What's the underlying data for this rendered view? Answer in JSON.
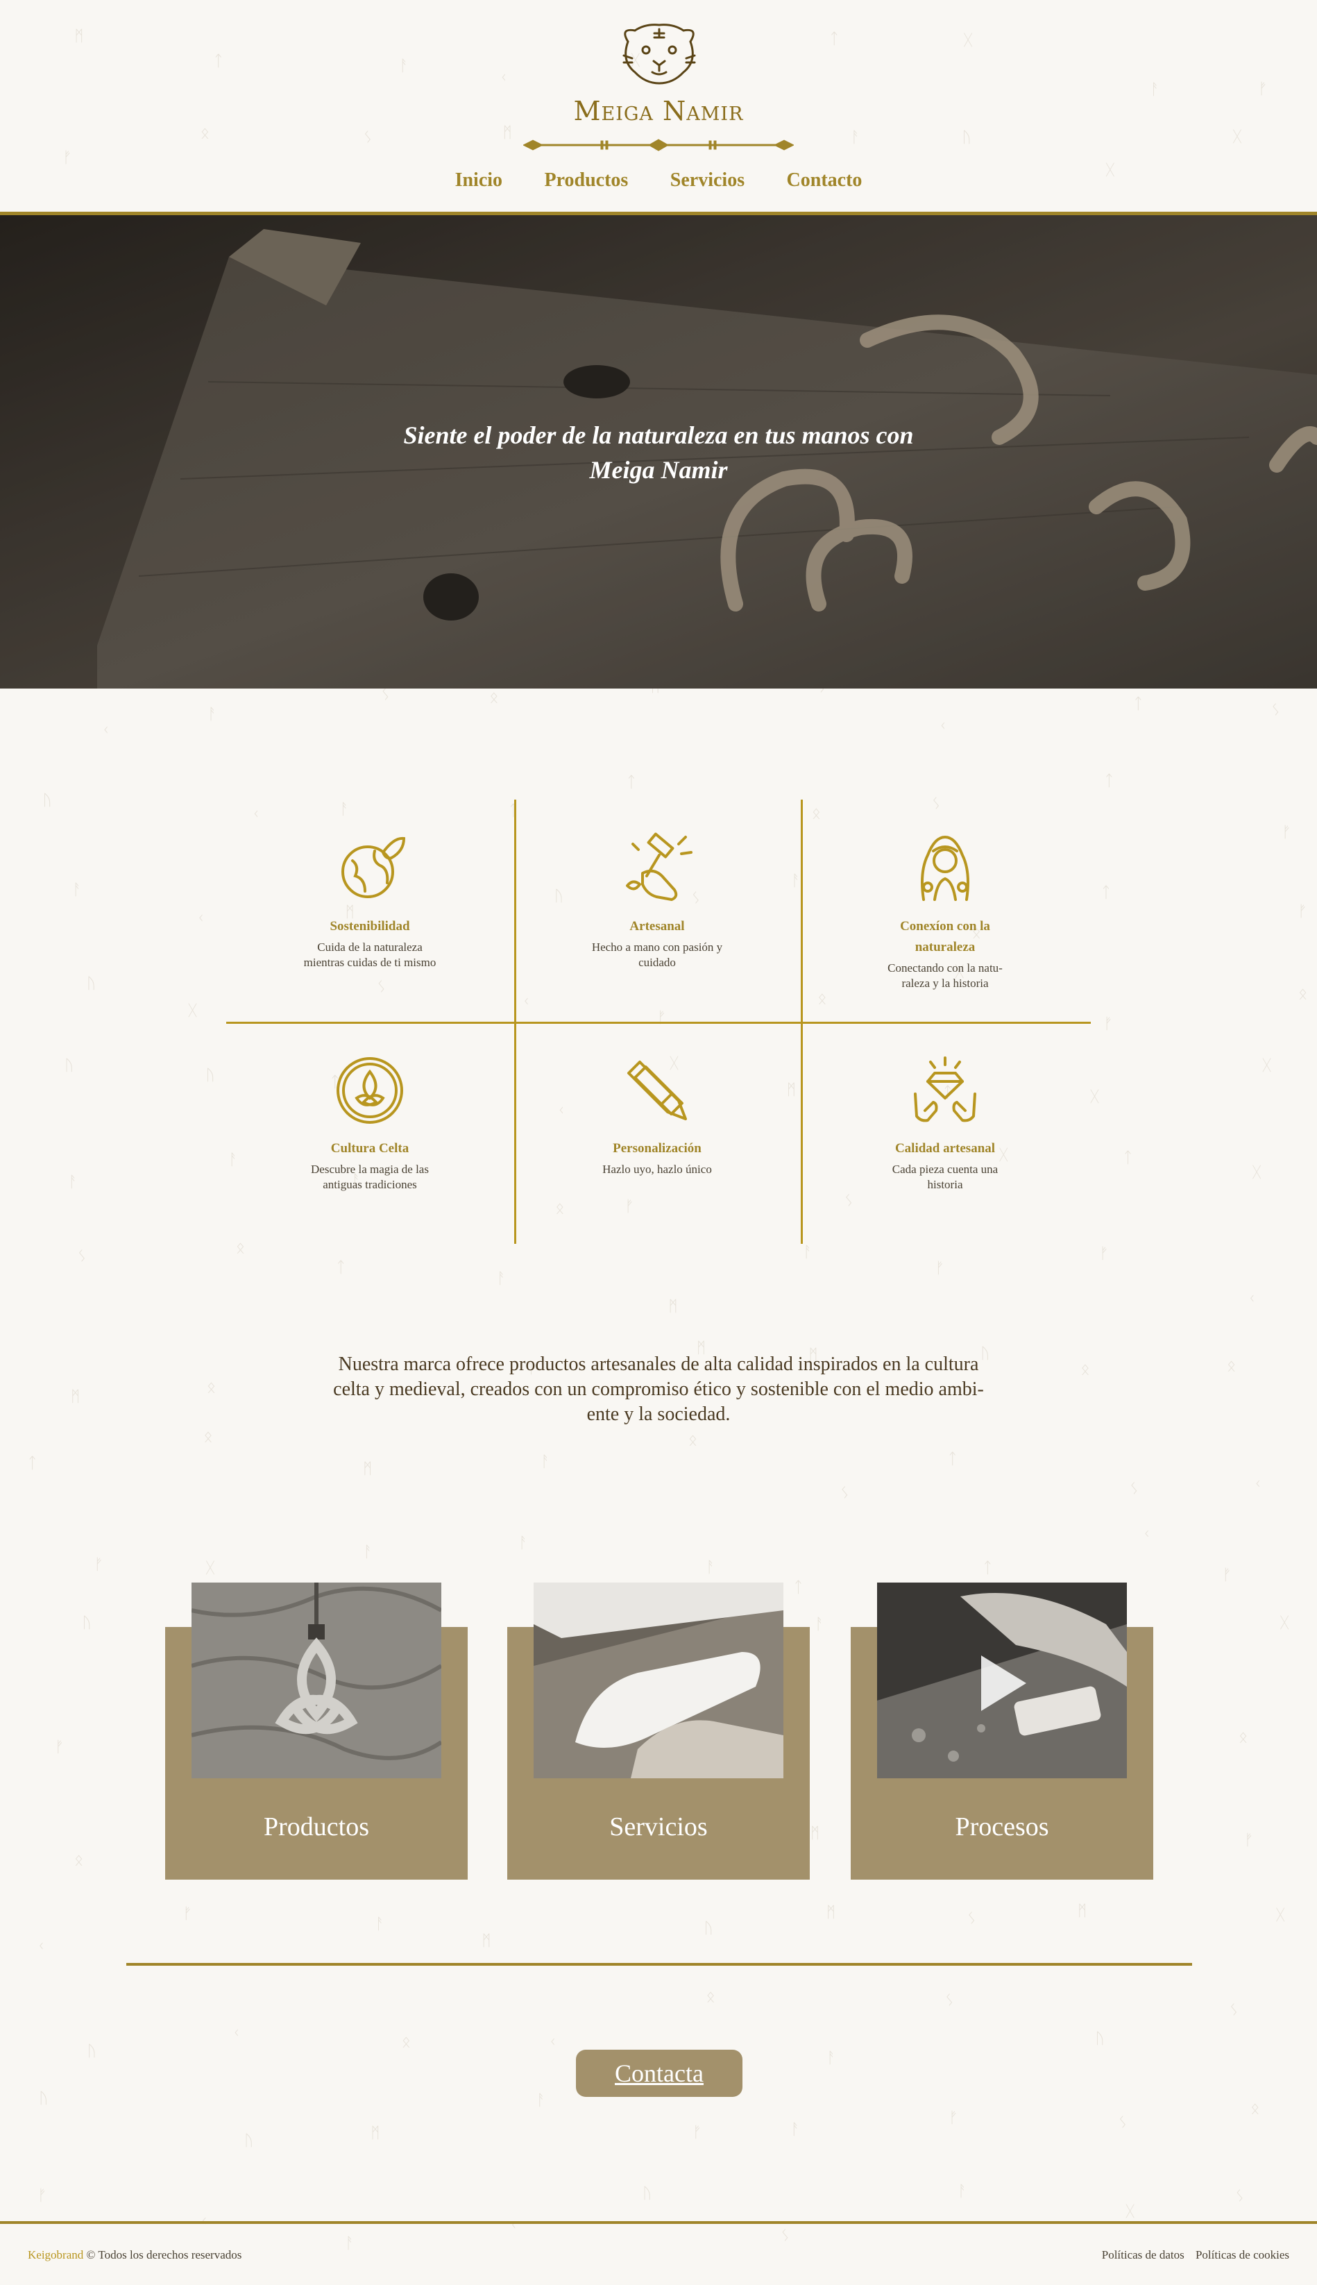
{
  "brand": {
    "name": "Meiga Namir"
  },
  "nav": {
    "items": [
      "Inicio",
      "Productos",
      "Servicios",
      "Contacto"
    ]
  },
  "hero": {
    "headline": "Siente el poder de la naturaleza en tus manos con Meiga Namir"
  },
  "features": [
    {
      "title": "Sostenibilidad",
      "text": "Cuida de la naturaleza mientras cuidas de ti mismo",
      "icon": "globe-leaf-icon"
    },
    {
      "title": "Artesanal",
      "text": "Hecho a mano con pasión y cuidado",
      "icon": "hand-hammer-icon"
    },
    {
      "title": "Conexíon con la naturaleza",
      "text": "Conectando con la natu- raleza y la historia",
      "icon": "forest-woman-icon"
    },
    {
      "title": "Cultura Celta",
      "text": "Descubre la magia de las antiguas tradiciones",
      "icon": "celtic-knot-icon"
    },
    {
      "title": "Personalización",
      "text": "Hazlo uyo, hazlo único",
      "icon": "pencil-ruler-icon"
    },
    {
      "title": "Calidad artesanal",
      "text": "Cada pieza cuenta una historia",
      "icon": "diamond-hands-icon"
    }
  ],
  "about": {
    "text": "Nuestra marca ofrece productos artesanales de alta calidad inspirados en la cultura celta y medieval, creados con un compromiso ético y sostenible con el medio ambi- ente y la sociedad."
  },
  "cards": [
    {
      "title": "Productos"
    },
    {
      "title": "Servicios"
    },
    {
      "title": "Procesos"
    }
  ],
  "cta": {
    "label": "Contacta"
  },
  "footer": {
    "brand": "Keigobrand",
    "rights": "© Todos los derechos reservados",
    "links": [
      "Políticas de datos",
      "Políticas de cookies"
    ]
  },
  "colors": {
    "gold": "#a08529",
    "card": "#a3916b",
    "background": "#f9f7f3"
  }
}
